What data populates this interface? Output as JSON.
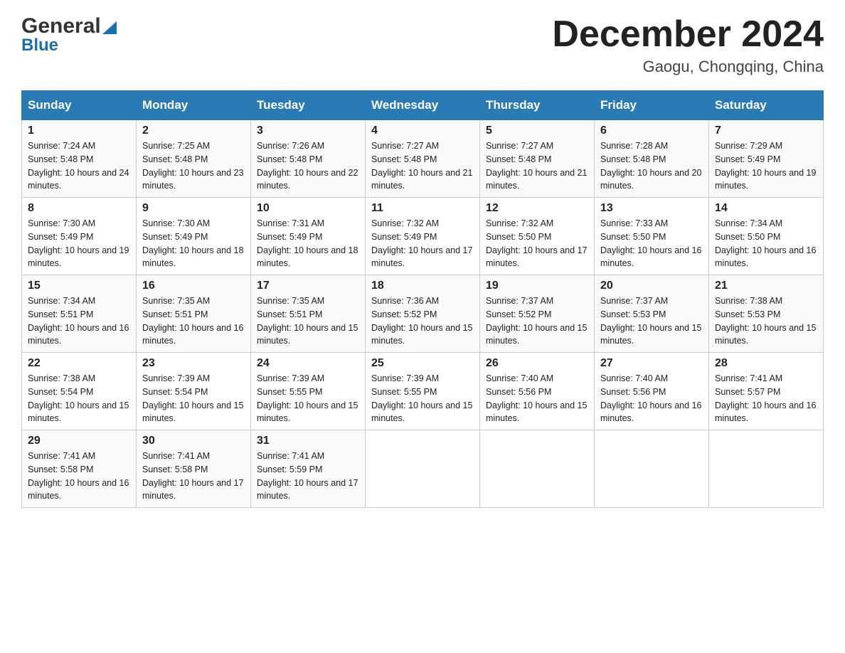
{
  "logo": {
    "name": "General",
    "name2": "Blue"
  },
  "title": "December 2024",
  "subtitle": "Gaogu, Chongqing, China",
  "days_of_week": [
    "Sunday",
    "Monday",
    "Tuesday",
    "Wednesday",
    "Thursday",
    "Friday",
    "Saturday"
  ],
  "weeks": [
    [
      {
        "day": "1",
        "sunrise": "7:24 AM",
        "sunset": "5:48 PM",
        "daylight": "10 hours and 24 minutes."
      },
      {
        "day": "2",
        "sunrise": "7:25 AM",
        "sunset": "5:48 PM",
        "daylight": "10 hours and 23 minutes."
      },
      {
        "day": "3",
        "sunrise": "7:26 AM",
        "sunset": "5:48 PM",
        "daylight": "10 hours and 22 minutes."
      },
      {
        "day": "4",
        "sunrise": "7:27 AM",
        "sunset": "5:48 PM",
        "daylight": "10 hours and 21 minutes."
      },
      {
        "day": "5",
        "sunrise": "7:27 AM",
        "sunset": "5:48 PM",
        "daylight": "10 hours and 21 minutes."
      },
      {
        "day": "6",
        "sunrise": "7:28 AM",
        "sunset": "5:48 PM",
        "daylight": "10 hours and 20 minutes."
      },
      {
        "day": "7",
        "sunrise": "7:29 AM",
        "sunset": "5:49 PM",
        "daylight": "10 hours and 19 minutes."
      }
    ],
    [
      {
        "day": "8",
        "sunrise": "7:30 AM",
        "sunset": "5:49 PM",
        "daylight": "10 hours and 19 minutes."
      },
      {
        "day": "9",
        "sunrise": "7:30 AM",
        "sunset": "5:49 PM",
        "daylight": "10 hours and 18 minutes."
      },
      {
        "day": "10",
        "sunrise": "7:31 AM",
        "sunset": "5:49 PM",
        "daylight": "10 hours and 18 minutes."
      },
      {
        "day": "11",
        "sunrise": "7:32 AM",
        "sunset": "5:49 PM",
        "daylight": "10 hours and 17 minutes."
      },
      {
        "day": "12",
        "sunrise": "7:32 AM",
        "sunset": "5:50 PM",
        "daylight": "10 hours and 17 minutes."
      },
      {
        "day": "13",
        "sunrise": "7:33 AM",
        "sunset": "5:50 PM",
        "daylight": "10 hours and 16 minutes."
      },
      {
        "day": "14",
        "sunrise": "7:34 AM",
        "sunset": "5:50 PM",
        "daylight": "10 hours and 16 minutes."
      }
    ],
    [
      {
        "day": "15",
        "sunrise": "7:34 AM",
        "sunset": "5:51 PM",
        "daylight": "10 hours and 16 minutes."
      },
      {
        "day": "16",
        "sunrise": "7:35 AM",
        "sunset": "5:51 PM",
        "daylight": "10 hours and 16 minutes."
      },
      {
        "day": "17",
        "sunrise": "7:35 AM",
        "sunset": "5:51 PM",
        "daylight": "10 hours and 15 minutes."
      },
      {
        "day": "18",
        "sunrise": "7:36 AM",
        "sunset": "5:52 PM",
        "daylight": "10 hours and 15 minutes."
      },
      {
        "day": "19",
        "sunrise": "7:37 AM",
        "sunset": "5:52 PM",
        "daylight": "10 hours and 15 minutes."
      },
      {
        "day": "20",
        "sunrise": "7:37 AM",
        "sunset": "5:53 PM",
        "daylight": "10 hours and 15 minutes."
      },
      {
        "day": "21",
        "sunrise": "7:38 AM",
        "sunset": "5:53 PM",
        "daylight": "10 hours and 15 minutes."
      }
    ],
    [
      {
        "day": "22",
        "sunrise": "7:38 AM",
        "sunset": "5:54 PM",
        "daylight": "10 hours and 15 minutes."
      },
      {
        "day": "23",
        "sunrise": "7:39 AM",
        "sunset": "5:54 PM",
        "daylight": "10 hours and 15 minutes."
      },
      {
        "day": "24",
        "sunrise": "7:39 AM",
        "sunset": "5:55 PM",
        "daylight": "10 hours and 15 minutes."
      },
      {
        "day": "25",
        "sunrise": "7:39 AM",
        "sunset": "5:55 PM",
        "daylight": "10 hours and 15 minutes."
      },
      {
        "day": "26",
        "sunrise": "7:40 AM",
        "sunset": "5:56 PM",
        "daylight": "10 hours and 15 minutes."
      },
      {
        "day": "27",
        "sunrise": "7:40 AM",
        "sunset": "5:56 PM",
        "daylight": "10 hours and 16 minutes."
      },
      {
        "day": "28",
        "sunrise": "7:41 AM",
        "sunset": "5:57 PM",
        "daylight": "10 hours and 16 minutes."
      }
    ],
    [
      {
        "day": "29",
        "sunrise": "7:41 AM",
        "sunset": "5:58 PM",
        "daylight": "10 hours and 16 minutes."
      },
      {
        "day": "30",
        "sunrise": "7:41 AM",
        "sunset": "5:58 PM",
        "daylight": "10 hours and 17 minutes."
      },
      {
        "day": "31",
        "sunrise": "7:41 AM",
        "sunset": "5:59 PM",
        "daylight": "10 hours and 17 minutes."
      },
      null,
      null,
      null,
      null
    ]
  ]
}
